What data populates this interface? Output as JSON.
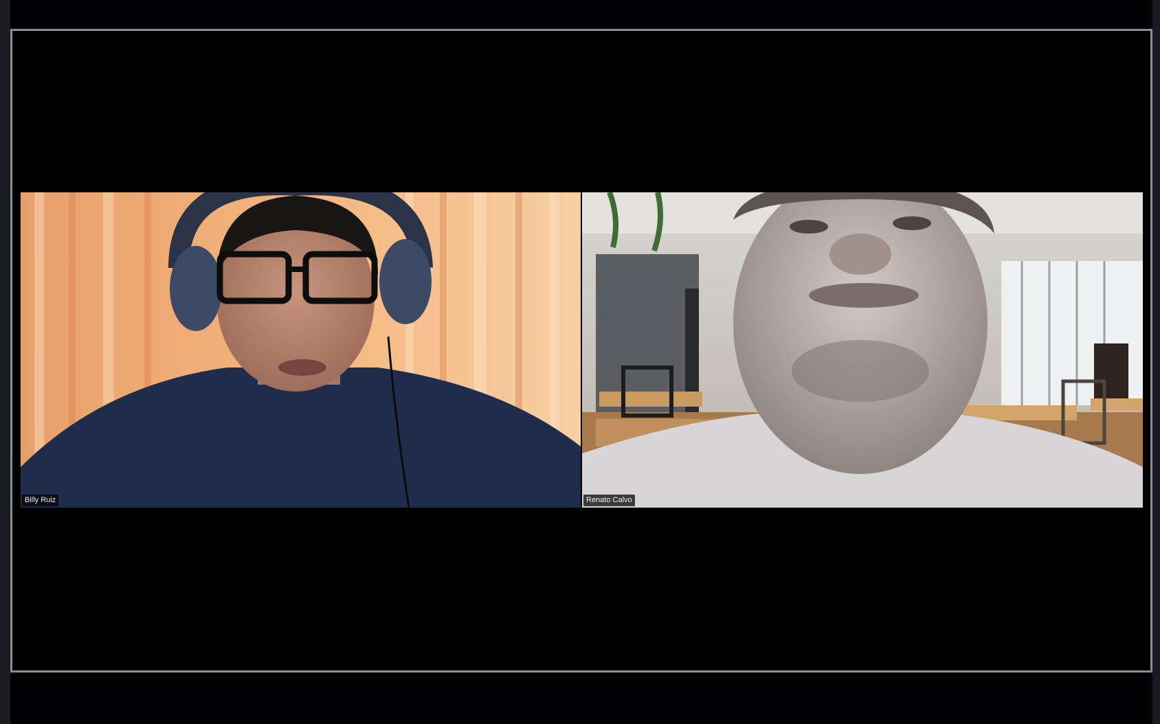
{
  "participants": [
    {
      "name": "Billy Ruiz"
    },
    {
      "name": "Renato Calvo"
    }
  ],
  "colors": {
    "background": "#000000",
    "frame_border": "#8c8c96",
    "name_tag_bg": "#000000",
    "name_tag_text": "#f2f2f2"
  }
}
